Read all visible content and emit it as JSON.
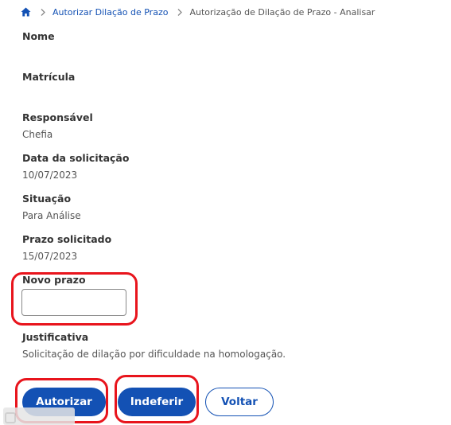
{
  "breadcrumb": {
    "home_icon": "home-icon",
    "separator_icon": "chevron-right-icon",
    "link_label": "Autorizar Dilação de Prazo",
    "current_label": "Autorização de Dilação de Prazo - Analisar"
  },
  "fields": {
    "nome": {
      "label": "Nome",
      "value": ""
    },
    "matricula": {
      "label": "Matrícula",
      "value": ""
    },
    "responsavel": {
      "label": "Responsável",
      "value": "Chefia"
    },
    "data_solicitacao": {
      "label": "Data da solicitação",
      "value": "10/07/2023"
    },
    "situacao": {
      "label": "Situação",
      "value": "Para Análise"
    },
    "prazo_solicitado": {
      "label": "Prazo solicitado",
      "value": "15/07/2023"
    },
    "novo_prazo": {
      "label": "Novo prazo",
      "value": ""
    },
    "justificativa": {
      "label": "Justificativa",
      "value": "Solicitação de dilação por dificuldade na homologação."
    }
  },
  "actions": {
    "autorizar_label": "Autorizar",
    "indeferir_label": "Indeferir",
    "voltar_label": "Voltar"
  },
  "colors": {
    "primary": "#1351b4",
    "annotation": "#e8141c",
    "text": "#333333"
  }
}
